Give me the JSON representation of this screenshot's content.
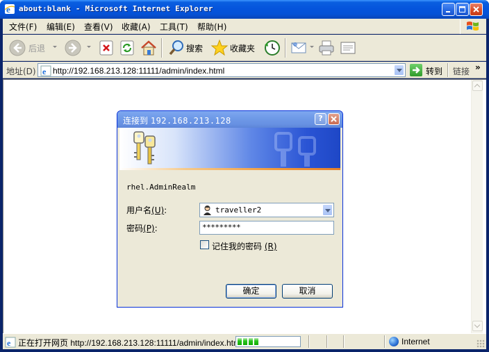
{
  "window": {
    "title": "about:blank - Microsoft Internet Explorer",
    "controls": {
      "minimize": "minimize",
      "maximize": "maximize",
      "close": "close"
    }
  },
  "menubar": {
    "items": [
      "文件(F)",
      "编辑(E)",
      "查看(V)",
      "收藏(A)",
      "工具(T)",
      "帮助(H)"
    ]
  },
  "toolbar": {
    "back_label": "后退",
    "search_label": "搜索",
    "favorites_label": "收藏夹",
    "icons": [
      "back-icon",
      "forward-icon",
      "stop-icon",
      "refresh-icon",
      "home-icon",
      "search-icon",
      "favorites-icon",
      "history-icon",
      "mail-icon",
      "print-icon",
      "edit-icon"
    ]
  },
  "addressbar": {
    "label": "地址(D)",
    "url": "http://192.168.213.128:11111/admin/index.html",
    "go_label": "转到",
    "links_label": "链接",
    "links_chevron": "»"
  },
  "dialog": {
    "title_prefix": "连接到",
    "title_host": "192.168.213.128",
    "help": "?",
    "realm": "rhel.AdminRealm",
    "user_label_text": "用户名",
    "user_label_key": "(U)",
    "user_label_suffix": ":",
    "username": "traveller2",
    "password_label_text": "密码",
    "password_label_key": "(P)",
    "password_label_suffix": ":",
    "password_masked": "*********",
    "remember_label_text": "记住我的密码",
    "remember_label_key": "(R)",
    "remember_checked": false,
    "ok_label": "确定",
    "cancel_label": "取消"
  },
  "statusbar": {
    "text": "正在打开网页 http://192.168.213.128:11111/admin/index.htm",
    "progress_segments": 4,
    "zone_label": "Internet"
  },
  "colors": {
    "titlebar": "#0554dc",
    "dialog_title": "#6f9be8",
    "chrome": "#ece9d8",
    "progress": "#2ac51e"
  }
}
